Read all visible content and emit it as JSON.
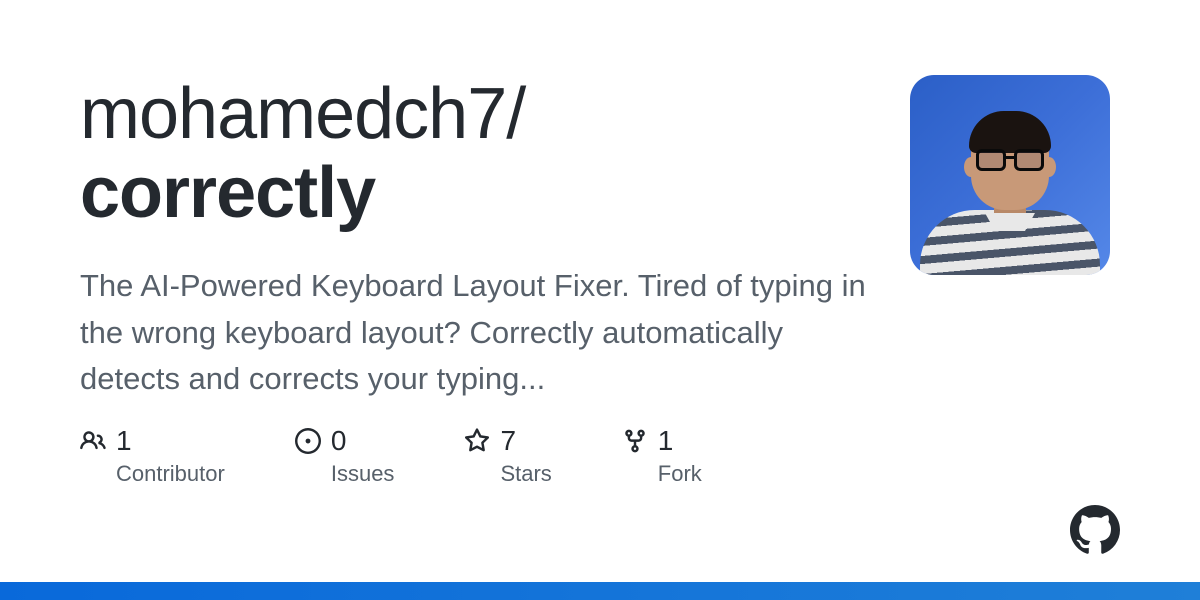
{
  "repo": {
    "owner": "mohamedch7/",
    "name": "correctly"
  },
  "description": "The AI-Powered Keyboard Layout Fixer. Tired of typing in the wrong keyboard layout? Correctly automatically detects and corrects your typing...",
  "stats": {
    "contributors": {
      "count": "1",
      "label": "Contributor"
    },
    "issues": {
      "count": "0",
      "label": "Issues"
    },
    "stars": {
      "count": "7",
      "label": "Stars"
    },
    "forks": {
      "count": "1",
      "label": "Fork"
    }
  }
}
